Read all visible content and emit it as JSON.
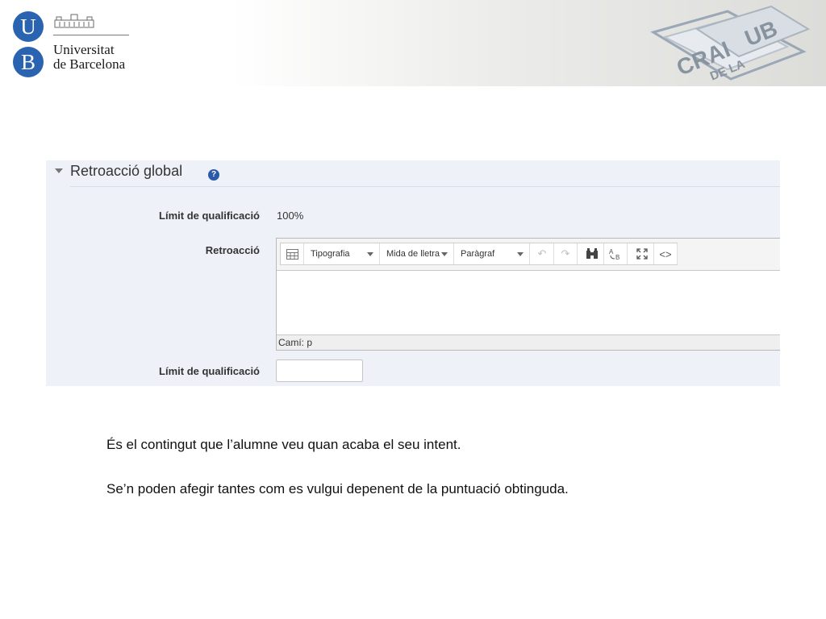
{
  "header": {
    "logo_letters": [
      "U",
      "B"
    ],
    "university_name_line1": "Universitat",
    "university_name_line2": "de Barcelona",
    "crai_logo_text": [
      "CRAI",
      "DE LA",
      "UB"
    ]
  },
  "section": {
    "title": "Retroacció global",
    "help_glyph": "?",
    "rows": [
      {
        "label": "Límit de qualificació",
        "value": "100%"
      },
      {
        "label": "Retroacció"
      },
      {
        "label": "Límit de qualificació",
        "input_value": ""
      }
    ]
  },
  "editor": {
    "toolbar": {
      "typography": "Tipografia",
      "font_size": "Mida de lletra",
      "paragraph": "Paràgraf"
    },
    "path": "Camí: p"
  },
  "captions": [
    "És el contingut que l’alumne veu quan acaba el seu intent.",
    "Se’n poden afegir tantes com es vulgui depenent de la puntuació obtinguda."
  ],
  "icons": [
    "grid-icon",
    "undo-icon",
    "redo-icon",
    "find-icon",
    "replace-icon",
    "fullscreen-icon",
    "code-icon",
    "help-icon"
  ],
  "colors": {
    "ub_blue": "#2a64b0",
    "panel_bg": "#eef2f8",
    "help_blue": "#2a5aa8"
  }
}
